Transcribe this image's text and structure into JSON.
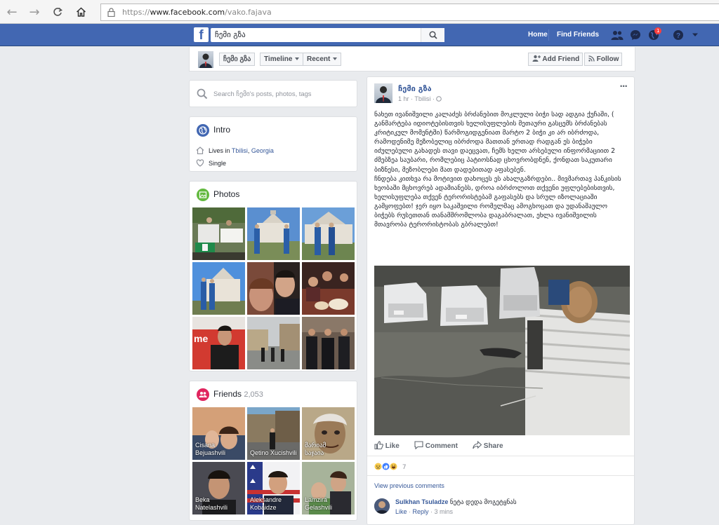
{
  "browser": {
    "url_scheme": "https://",
    "url_domain": "www.facebook.com",
    "url_path": "/vako.fajava"
  },
  "topbar": {
    "logo": "f",
    "search_value": "ჩემი გზა",
    "home": "Home",
    "find_friends": "Find Friends",
    "notif_count": "1"
  },
  "timeline": {
    "page_name": "ჩემი გზა",
    "tab_timeline": "Timeline",
    "tab_recent": "Recent",
    "add_friend": "Add Friend",
    "follow": "Follow"
  },
  "search_posts": {
    "placeholder": "Search ჩემი's posts, photos, tags"
  },
  "intro": {
    "title": "Intro",
    "lives_prefix": "Lives in ",
    "city": "Tbilisi",
    "sep": ", ",
    "country": "Georgia",
    "relationship": "Single"
  },
  "photos": {
    "title": "Photos"
  },
  "friends": {
    "title": "Friends",
    "count": "2,053",
    "items": [
      {
        "name_line1": "Cisana",
        "name_line2": "Bejuashvili"
      },
      {
        "name_line1": "",
        "name_line2": "Qetino Xucishvili"
      },
      {
        "name_line1": "მარიამ",
        "name_line2": "საჯაია"
      },
      {
        "name_line1": "Beka",
        "name_line2": "Natelashvili"
      },
      {
        "name_line1": "Aleksandre",
        "name_line2": "Kobaidze"
      },
      {
        "name_line1": "Lamzira",
        "name_line2": "Gelashvili"
      }
    ]
  },
  "post": {
    "author": "ჩემი გზა",
    "time": "1 hr",
    "dot": " · ",
    "location": "Tbilisi",
    "more": "···",
    "paragraph1": "ნახეთ ივანიშვილი კალაძეს ბრძანებით მოკლული ბიჭი სად ადგია ქუჩაში, ( განმარტება იდიოტებისთვის ხელისუფლების მეთაური გასცემს ბრძანებას კრიტიკულ მომენტში) წარმოგიდგენიათ მარტო 2 ბიჭი კი არ იბრძოდა, რამოდენიმე მეზობელიც იბრძოდა მათთან ერთად რადგან ეს ბიჭები იძულებული გახადეს თავი დაეცვათ, ჩემს ხელთ არსებული ინფორმაციით 2 ძმებზეა საუბარი, რომლებიც პატიოსნად ცხოვრობდნენ, ქონდათ საკუთარი ბიზნესი, მეზობლები მათ დადებითად აფასებენ.",
    "paragraph2": "ჩნდება კითხვა რა მოტივით დახოცეს ეს ახალგაზრდები.. მივმართავ პანკისის ხეობაში მცხოვრებ ადამიანებს, დროა იბრძოლოთ თქვენი უფლებებისთვის, ხელისუფლება თქვენ ტერორისტებამ გაფასებს და სრულ იზოლაციაში გამყოფებთ! ჯერ იყო საკაშვილი რომელმაც ამოგხოცათ და უდანაშაულო ბიჭებს რუსეთთან თანამშრომლობა დაგაბრალათ, ეხლა ივანიშვილის მთავრობა ტერორისტობას გბრალებთ!",
    "like": "Like",
    "comment": "Comment",
    "share": "Share",
    "reaction_count": "7",
    "view_previous": "View previous comments",
    "comment_author": "Sulkhan Tsuladze",
    "comment_text": "ნეტა დედა მოგეტყნას",
    "comment_like": "Like",
    "comment_reply": "Reply",
    "comment_time": "3 mins",
    "comment_dot": " · "
  }
}
